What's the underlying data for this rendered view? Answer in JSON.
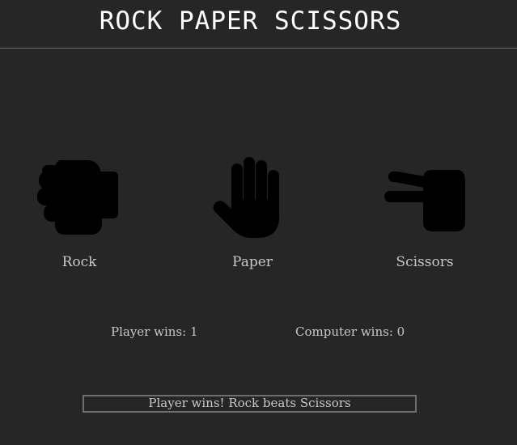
{
  "header": {
    "title": "ROCK PAPER SCISSORS"
  },
  "choices": [
    {
      "label": "Rock",
      "icon": "fist-icon"
    },
    {
      "label": "Paper",
      "icon": "open-hand-icon"
    },
    {
      "label": "Scissors",
      "icon": "scissors-hand-icon"
    }
  ],
  "scores": {
    "player_label": "Player wins: ",
    "player_value": "1",
    "computer_label": "Computer wins: ",
    "computer_value": "0"
  },
  "result": {
    "message": "Player wins! Rock beats Scissors"
  },
  "colors": {
    "background": "#262626",
    "icon": "#000000",
    "text": "#c8c8c8",
    "title": "#ffffff"
  }
}
